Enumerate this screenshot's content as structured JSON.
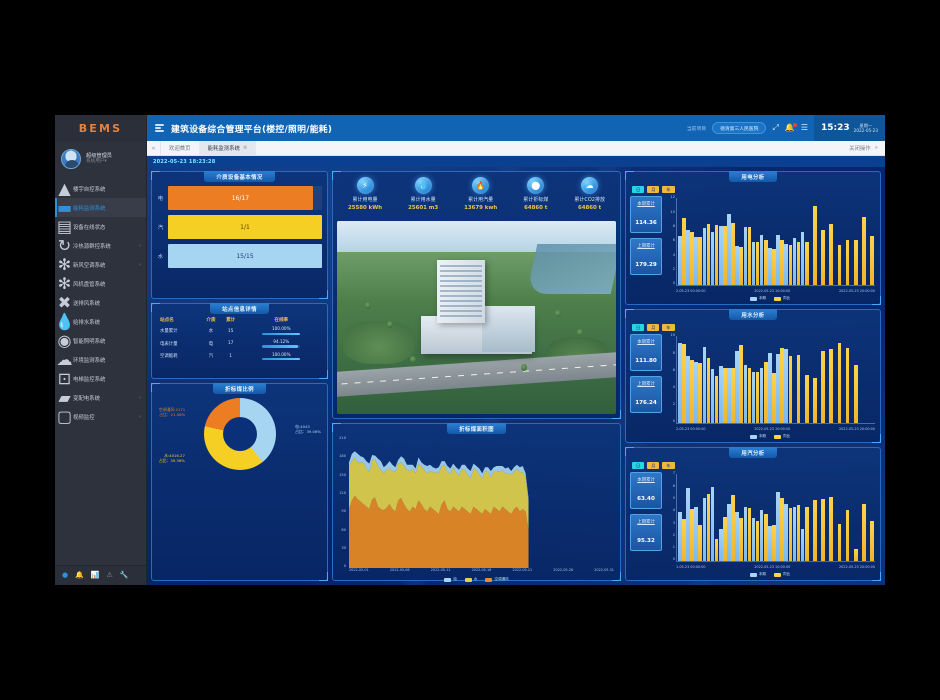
{
  "brand": {
    "name": "BEMS"
  },
  "user": {
    "name": "超级管理员",
    "role": "系统用户",
    "caret": "▾"
  },
  "sidebar": {
    "items": [
      {
        "label": "楼宇自控系统",
        "icon": "sitemap-icon",
        "arrow": "",
        "active": false
      },
      {
        "label": "能耗监测系统",
        "icon": "chart-bar-icon",
        "arrow": "",
        "active": true
      },
      {
        "label": "设备在线状态",
        "icon": "server-icon",
        "arrow": "",
        "active": false
      },
      {
        "label": "冷热源群控系统",
        "icon": "refresh-icon",
        "arrow": "›",
        "active": false
      },
      {
        "label": "新风空调系统",
        "icon": "fan-icon",
        "arrow": "›",
        "active": false
      },
      {
        "label": "风机盘管系统",
        "icon": "fan-icon",
        "arrow": "",
        "active": false
      },
      {
        "label": "送排风系统",
        "icon": "airflow-icon",
        "arrow": "",
        "active": false
      },
      {
        "label": "给排水系统",
        "icon": "water-drop-icon",
        "arrow": "",
        "active": false
      },
      {
        "label": "智能照明系统",
        "icon": "lightbulb-icon",
        "arrow": "",
        "active": false
      },
      {
        "label": "环境监测系统",
        "icon": "cloud-icon",
        "arrow": "",
        "active": false
      },
      {
        "label": "电梯监控系统",
        "icon": "elevator-icon",
        "arrow": "",
        "active": false
      },
      {
        "label": "变配电系统",
        "icon": "power-icon",
        "arrow": "›",
        "active": false
      },
      {
        "label": "视频监控",
        "icon": "video-camera-icon",
        "arrow": "›",
        "active": false
      }
    ],
    "taskbar": [
      {
        "icon": "home-indicator-icon",
        "glyph": "●",
        "active": true
      },
      {
        "icon": "bell-icon",
        "glyph": "🔔",
        "active": false
      },
      {
        "icon": "chart-icon",
        "glyph": "📊",
        "active": false
      },
      {
        "icon": "alert-icon",
        "glyph": "⚠",
        "active": false
      },
      {
        "icon": "tools-icon",
        "glyph": "🔧",
        "active": false
      }
    ]
  },
  "topbar": {
    "title": "建筑设备综合管理平台(楼控/照明/能耗)",
    "project_label": "当前项目",
    "project_name": "德清第三人民医院",
    "fullscreen_icon": "expand-icon",
    "bell_icon": "bell-icon",
    "menu_icon": "list-icon",
    "time": "15:23",
    "weekday": "星期一",
    "date": "2022-05-23"
  },
  "tabstrip": {
    "prev_glyph": "«",
    "tabs": [
      {
        "label": "欢迎首页",
        "active": false,
        "closable": false
      },
      {
        "label": "能耗监测系统",
        "active": true,
        "closable": true
      }
    ],
    "right_label": "关闭操作",
    "right_glyph": "»"
  },
  "timestamp": "2022-05-23 18:23:28",
  "media_panel": {
    "title": "介质设备基本情况",
    "bars": [
      {
        "label": "电",
        "value": "16/17",
        "pct": 94,
        "color": "#ec7d22"
      },
      {
        "label": "汽",
        "value": "1/1",
        "pct": 100,
        "color": "#f5cf23"
      },
      {
        "label": "水",
        "value": "15/15",
        "pct": 100,
        "color": "#a6d5f2"
      }
    ]
  },
  "site_table": {
    "title": "站点信息详情",
    "columns": [
      "站点名",
      "介质",
      "累计",
      "在线率"
    ],
    "rows": [
      {
        "name": "水量累计",
        "media": "水",
        "total": "15",
        "rate": "100.00%",
        "rate_pct": 100
      },
      {
        "name": "电表计量",
        "media": "电",
        "total": "17",
        "rate": "94.12%",
        "rate_pct": 94
      },
      {
        "name": "空调能耗",
        "media": "汽",
        "total": "1",
        "rate": "100.00%",
        "rate_pct": 100
      }
    ]
  },
  "kpis": [
    {
      "name": "累计用电量",
      "value": "25580 kWh",
      "icon": "bolt-icon",
      "glyph": "⚡"
    },
    {
      "name": "累计用水量",
      "value": "25601 m3",
      "icon": "water-drop-icon",
      "glyph": "💧"
    },
    {
      "name": "累计用汽量",
      "value": "13679 kwh",
      "icon": "flame-icon",
      "glyph": "🔥"
    },
    {
      "name": "累计折标煤",
      "value": "64860 t",
      "icon": "coal-icon",
      "glyph": "⬤"
    },
    {
      "name": "累计CO2排放",
      "value": "64860 t",
      "icon": "co2-icon",
      "glyph": "☁"
    }
  ],
  "building": {
    "alt": "园区鸟瞰效果图"
  },
  "donut_panel": {
    "title": "折标煤比例",
    "chart_data": {
      "type": "pie",
      "title": "折标煤比例",
      "legend": "labels",
      "slices": [
        {
          "name": "电",
          "value": 4045,
          "pct": 39.06,
          "color": "#a6d5f2",
          "label_line1": "电:4045",
          "label_line2": "占比：39.06%"
        },
        {
          "name": "水",
          "value": 4016.27,
          "pct": 39.36,
          "color": "#f5cf23",
          "label_line1": "水:4016.27",
          "label_line2": "占比：39.36%"
        },
        {
          "name": "空调通风",
          "value": 2171,
          "pct": 21.58,
          "color": "#ec7d22",
          "label_line1": "空调通风:2171",
          "label_line2": "占比：21.58%"
        }
      ]
    }
  },
  "area_panel": {
    "title": "折标煤面积图",
    "chart_data": {
      "type": "area",
      "title": "折标煤面积图",
      "stacked": true,
      "ylim": [
        0,
        210
      ],
      "yticks": [
        0,
        30,
        60,
        90,
        120,
        150,
        180,
        210
      ],
      "xticks": [
        "2022-05-01",
        "2022-05-06",
        "2022-05-11",
        "2022-05-16",
        "2022-05-21",
        "2022-05-26",
        "2022-05-31"
      ],
      "legend": [
        "电",
        "水",
        "空调通风"
      ],
      "colors": [
        "#a6d5f2",
        "#e3d14a",
        "#ec8b22"
      ],
      "series": [
        {
          "name": "空调通风",
          "color": "#ec8b22",
          "values": [
            96,
            110,
            118,
            112,
            108,
            104,
            100,
            96,
            112,
            115,
            100,
            96,
            94,
            98,
            104,
            96,
            92,
            110,
            114,
            104,
            96,
            92,
            100,
            96,
            110,
            104,
            96,
            92,
            100,
            96,
            92,
            88,
            104,
            110,
            96,
            92,
            100,
            96,
            92,
            100,
            96,
            92,
            88,
            100,
            96,
            92,
            88,
            96,
            92,
            88,
            100,
            96,
            92,
            100,
            96,
            92,
            88,
            96,
            100,
            92,
            96,
            92,
            62
          ]
        },
        {
          "name": "水",
          "color": "#e3d14a",
          "values": [
            68,
            64,
            62,
            60,
            64,
            68,
            62,
            60,
            64,
            62,
            66,
            64,
            60,
            62,
            58,
            62,
            64,
            60,
            58,
            62,
            64,
            66,
            62,
            58,
            60,
            62,
            64,
            62,
            58,
            60,
            64,
            66,
            62,
            58,
            60,
            62,
            64,
            60,
            58,
            62,
            64,
            60,
            58,
            62,
            64,
            60,
            58,
            62,
            64,
            60,
            58,
            62,
            64,
            60,
            58,
            62,
            64,
            60,
            62,
            64,
            60,
            56,
            48
          ]
        },
        {
          "name": "电",
          "color": "#a6d5f2",
          "values": [
            8,
            12,
            10,
            14,
            10,
            8,
            12,
            14,
            8,
            6,
            12,
            14,
            10,
            8,
            12,
            10,
            8,
            6,
            10,
            12,
            8,
            10,
            6,
            8,
            10,
            6,
            8,
            12,
            10,
            8,
            6,
            10,
            8,
            6,
            10,
            8,
            6,
            8,
            10,
            6,
            8,
            10,
            12,
            8,
            6,
            10,
            8,
            6,
            8,
            10,
            6,
            8,
            10,
            6,
            8,
            10,
            6,
            8,
            6,
            8,
            10,
            6,
            4
          ]
        }
      ]
    }
  },
  "analysis_panels": [
    {
      "title": "用电分析",
      "chips": [
        {
          "label": "日",
          "on": true
        },
        {
          "label": "月",
          "on": false
        },
        {
          "label": "年",
          "on": false
        }
      ],
      "stats": [
        {
          "label": "本期累计",
          "value": "114.36"
        },
        {
          "label": "上期累计",
          "value": "179.29"
        }
      ],
      "legend": [
        {
          "name": "本期",
          "color": "#a9d4f7"
        },
        {
          "name": "同比",
          "color": "#ffd34d"
        }
      ],
      "chart_data": {
        "type": "bar",
        "title": "用电分析",
        "ylim": [
          0,
          12
        ],
        "yticks": [
          0,
          2,
          4,
          6,
          8,
          10,
          12
        ],
        "xticks": [
          "2-05-23 00:00:00",
          "2022-05-23 10:00:00",
          "2022-05-23 20:00:00"
        ],
        "series": [
          {
            "name": "本期",
            "color": "#a9d4f7",
            "values": [
              6.8,
              7.6,
              6.6,
              7.9,
              7.3,
              8.2,
              9.9,
              5.4,
              8.1,
              6.0,
              7.0,
              5.1,
              6.9,
              5.7,
              6.5,
              7.4,
              0,
              0,
              0,
              0,
              0,
              0,
              0,
              0
            ]
          },
          {
            "name": "同比",
            "color": "#ffd34d",
            "values": [
              9.3,
              7.4,
              6.7,
              8.4,
              8.3,
              8.2,
              8.6,
              5.3,
              8.0,
              5.9,
              6.3,
              5.0,
              6.2,
              5.6,
              5.9,
              6.0,
              11.0,
              7.6,
              8.4,
              5.6,
              6.2,
              6.2,
              9.4,
              6.8
            ]
          }
        ]
      }
    },
    {
      "title": "用水分析",
      "chips": [
        {
          "label": "日",
          "on": true
        },
        {
          "label": "月",
          "on": false
        },
        {
          "label": "年",
          "on": false
        }
      ],
      "stats": [
        {
          "label": "本期累计",
          "value": "111.80"
        },
        {
          "label": "上期累计",
          "value": "176.24"
        }
      ],
      "legend": [
        {
          "name": "本期",
          "color": "#a9d4f7"
        },
        {
          "name": "同比",
          "color": "#ffd34d"
        }
      ],
      "chart_data": {
        "type": "bar",
        "title": "用水分析",
        "ylim": [
          0,
          10
        ],
        "yticks": [
          0,
          2,
          4,
          6,
          8,
          10
        ],
        "xticks": [
          "2-05-23 00:00:00",
          "2022-05-23 10:00:00",
          "2022-05-23 20:00:00"
        ],
        "series": [
          {
            "name": "本期",
            "color": "#a9d4f7",
            "values": [
              9.2,
              7.8,
              7.0,
              8.8,
              6.2,
              6.6,
              6.4,
              8.3,
              6.7,
              5.9,
              6.4,
              8.1,
              8.0,
              8.6,
              0,
              0,
              0,
              0,
              0,
              0,
              0,
              0,
              0,
              0
            ]
          },
          {
            "name": "同比",
            "color": "#ffd34d",
            "values": [
              9.1,
              7.3,
              6.9,
              7.5,
              5.4,
              6.3,
              6.4,
              9.0,
              6.3,
              5.9,
              7.0,
              5.8,
              8.7,
              7.7,
              7.9,
              5.6,
              5.2,
              8.3,
              8.5,
              9.3,
              8.7,
              6.7,
              0,
              0
            ]
          }
        ]
      }
    },
    {
      "title": "用汽分析",
      "chips": [
        {
          "label": "日",
          "on": true
        },
        {
          "label": "月",
          "on": false
        },
        {
          "label": "年",
          "on": false
        }
      ],
      "stats": [
        {
          "label": "本期累计",
          "value": "63.40"
        },
        {
          "label": "上期累计",
          "value": "95.32"
        }
      ],
      "legend": [
        {
          "name": "本期",
          "color": "#a9d4f7"
        },
        {
          "name": "同比",
          "color": "#ffd34d"
        }
      ],
      "chart_data": {
        "type": "bar",
        "title": "用汽分析",
        "ylim": [
          0,
          7
        ],
        "yticks": [
          0,
          1,
          2,
          3,
          4,
          5,
          6,
          7
        ],
        "xticks": [
          "1-05-23 00:00:00",
          "2022-05-23 10:00:00",
          "2022-05-23 20:00:00"
        ],
        "series": [
          {
            "name": "本期",
            "color": "#a9d4f7",
            "values": [
              4.0,
              5.9,
              4.4,
              5.1,
              6.0,
              2.6,
              4.6,
              4.0,
              4.4,
              3.5,
              4.1,
              2.8,
              5.6,
              4.6,
              4.4,
              2.6,
              0,
              0,
              0,
              0,
              0,
              0,
              0,
              0
            ]
          },
          {
            "name": "同比",
            "color": "#ffd34d",
            "values": [
              3.4,
              4.2,
              2.9,
              5.4,
              1.8,
              3.6,
              5.3,
              3.5,
              4.3,
              3.2,
              3.8,
              2.9,
              5.1,
              4.3,
              4.5,
              4.4,
              4.9,
              5.0,
              5.2,
              3.0,
              4.1,
              1.0,
              4.6,
              3.2
            ]
          }
        ]
      }
    }
  ]
}
